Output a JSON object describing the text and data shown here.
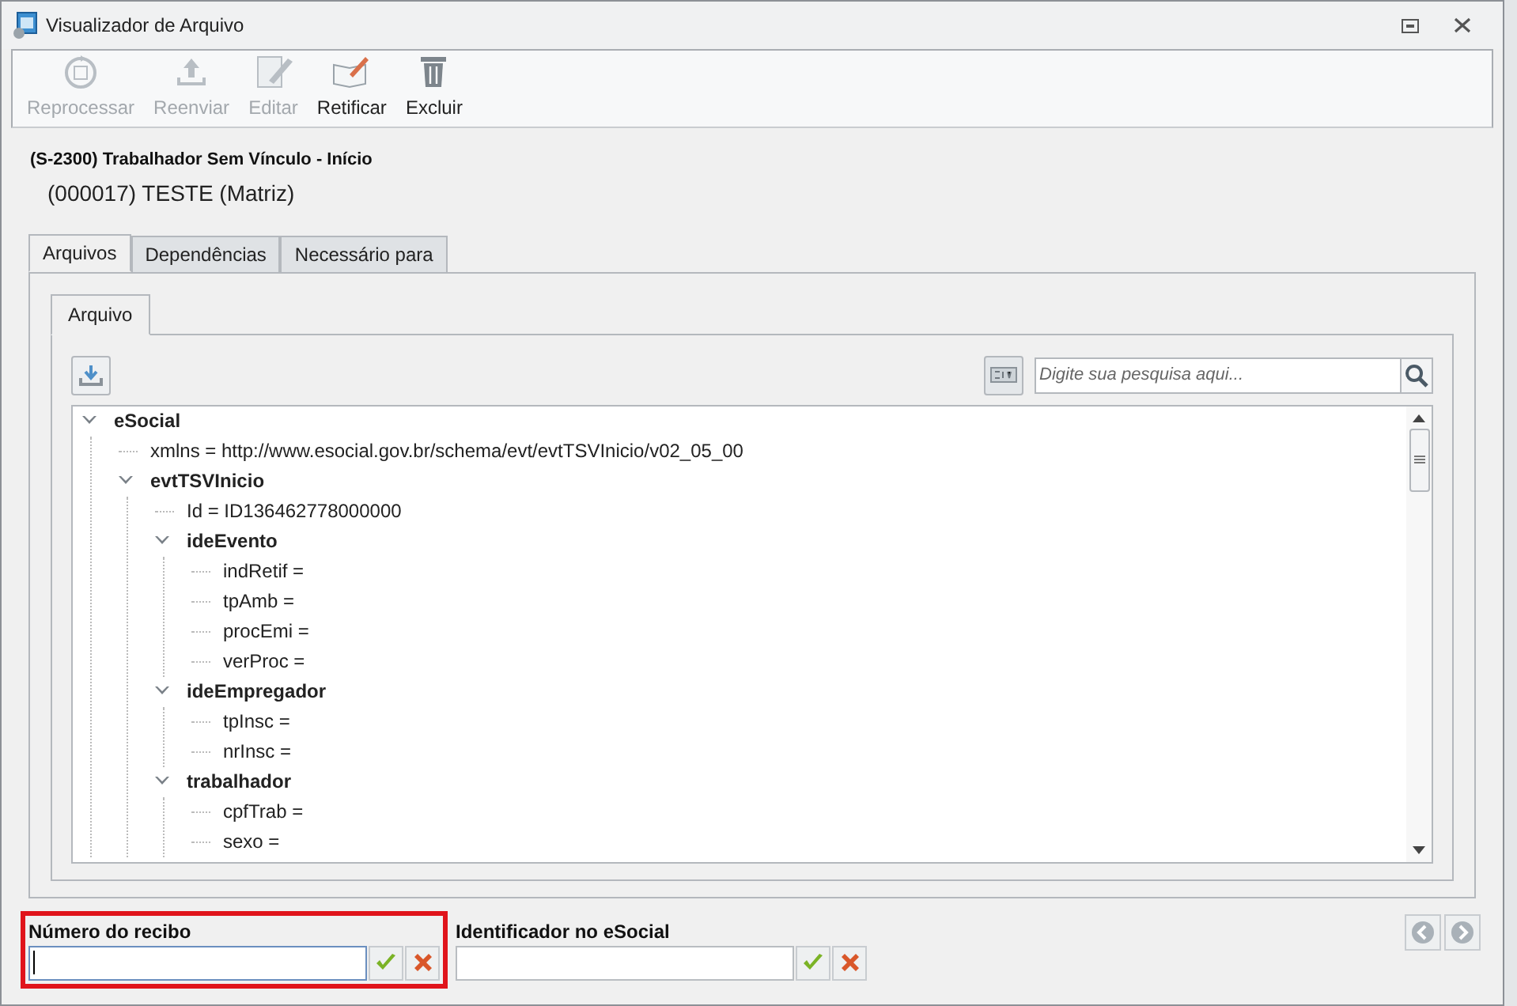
{
  "window": {
    "title": "Visualizador de Arquivo"
  },
  "toolbar": [
    {
      "kind": "reprocess",
      "label": "Reprocessar",
      "disabled": true
    },
    {
      "kind": "resend",
      "label": "Reenviar",
      "disabled": true
    },
    {
      "kind": "edit",
      "label": "Editar",
      "disabled": true
    },
    {
      "kind": "rectify",
      "label": "Retificar",
      "disabled": false
    },
    {
      "kind": "delete",
      "label": "Excluir",
      "disabled": false
    }
  ],
  "header": {
    "event": "(S-2300) Trabalhador Sem Vínculo - Início",
    "company": "(000017) TESTE (Matriz)"
  },
  "tabs": [
    {
      "label": "Arquivos",
      "selected": true
    },
    {
      "label": "Dependências",
      "selected": false
    },
    {
      "label": "Necessário para",
      "selected": false
    }
  ],
  "inner_tabs": [
    {
      "label": "Arquivo",
      "selected": true
    }
  ],
  "search": {
    "placeholder": "Digite sua pesquisa aqui..."
  },
  "tree": [
    {
      "kind": "element",
      "label": "eSocial",
      "expanded": true,
      "children": [
        {
          "kind": "attribute",
          "label": "xmlns = http://www.esocial.gov.br/schema/evt/evtTSVInicio/v02_05_00"
        },
        {
          "kind": "element",
          "label": "evtTSVInicio",
          "expanded": true,
          "children": [
            {
              "kind": "attribute",
              "label": "Id = ID136462778000000"
            },
            {
              "kind": "element",
              "label": "ideEvento",
              "expanded": true,
              "children": [
                {
                  "kind": "attribute",
                  "label": "indRetif ="
                },
                {
                  "kind": "attribute",
                  "label": "tpAmb ="
                },
                {
                  "kind": "attribute",
                  "label": "procEmi ="
                },
                {
                  "kind": "attribute",
                  "label": "verProc ="
                }
              ]
            },
            {
              "kind": "element",
              "label": "ideEmpregador",
              "expanded": true,
              "children": [
                {
                  "kind": "attribute",
                  "label": "tpInsc ="
                },
                {
                  "kind": "attribute",
                  "label": "nrInsc ="
                }
              ]
            },
            {
              "kind": "element",
              "label": "trabalhador",
              "expanded": true,
              "children": [
                {
                  "kind": "attribute",
                  "label": "cpfTrab ="
                },
                {
                  "kind": "attribute",
                  "label": "sexo ="
                }
              ]
            }
          ]
        }
      ]
    }
  ],
  "fields": [
    {
      "label": "Número do recibo",
      "highlighted": true,
      "focused": true
    },
    {
      "label": "Identificador no eSocial",
      "highlighted": false,
      "focused": false
    }
  ]
}
